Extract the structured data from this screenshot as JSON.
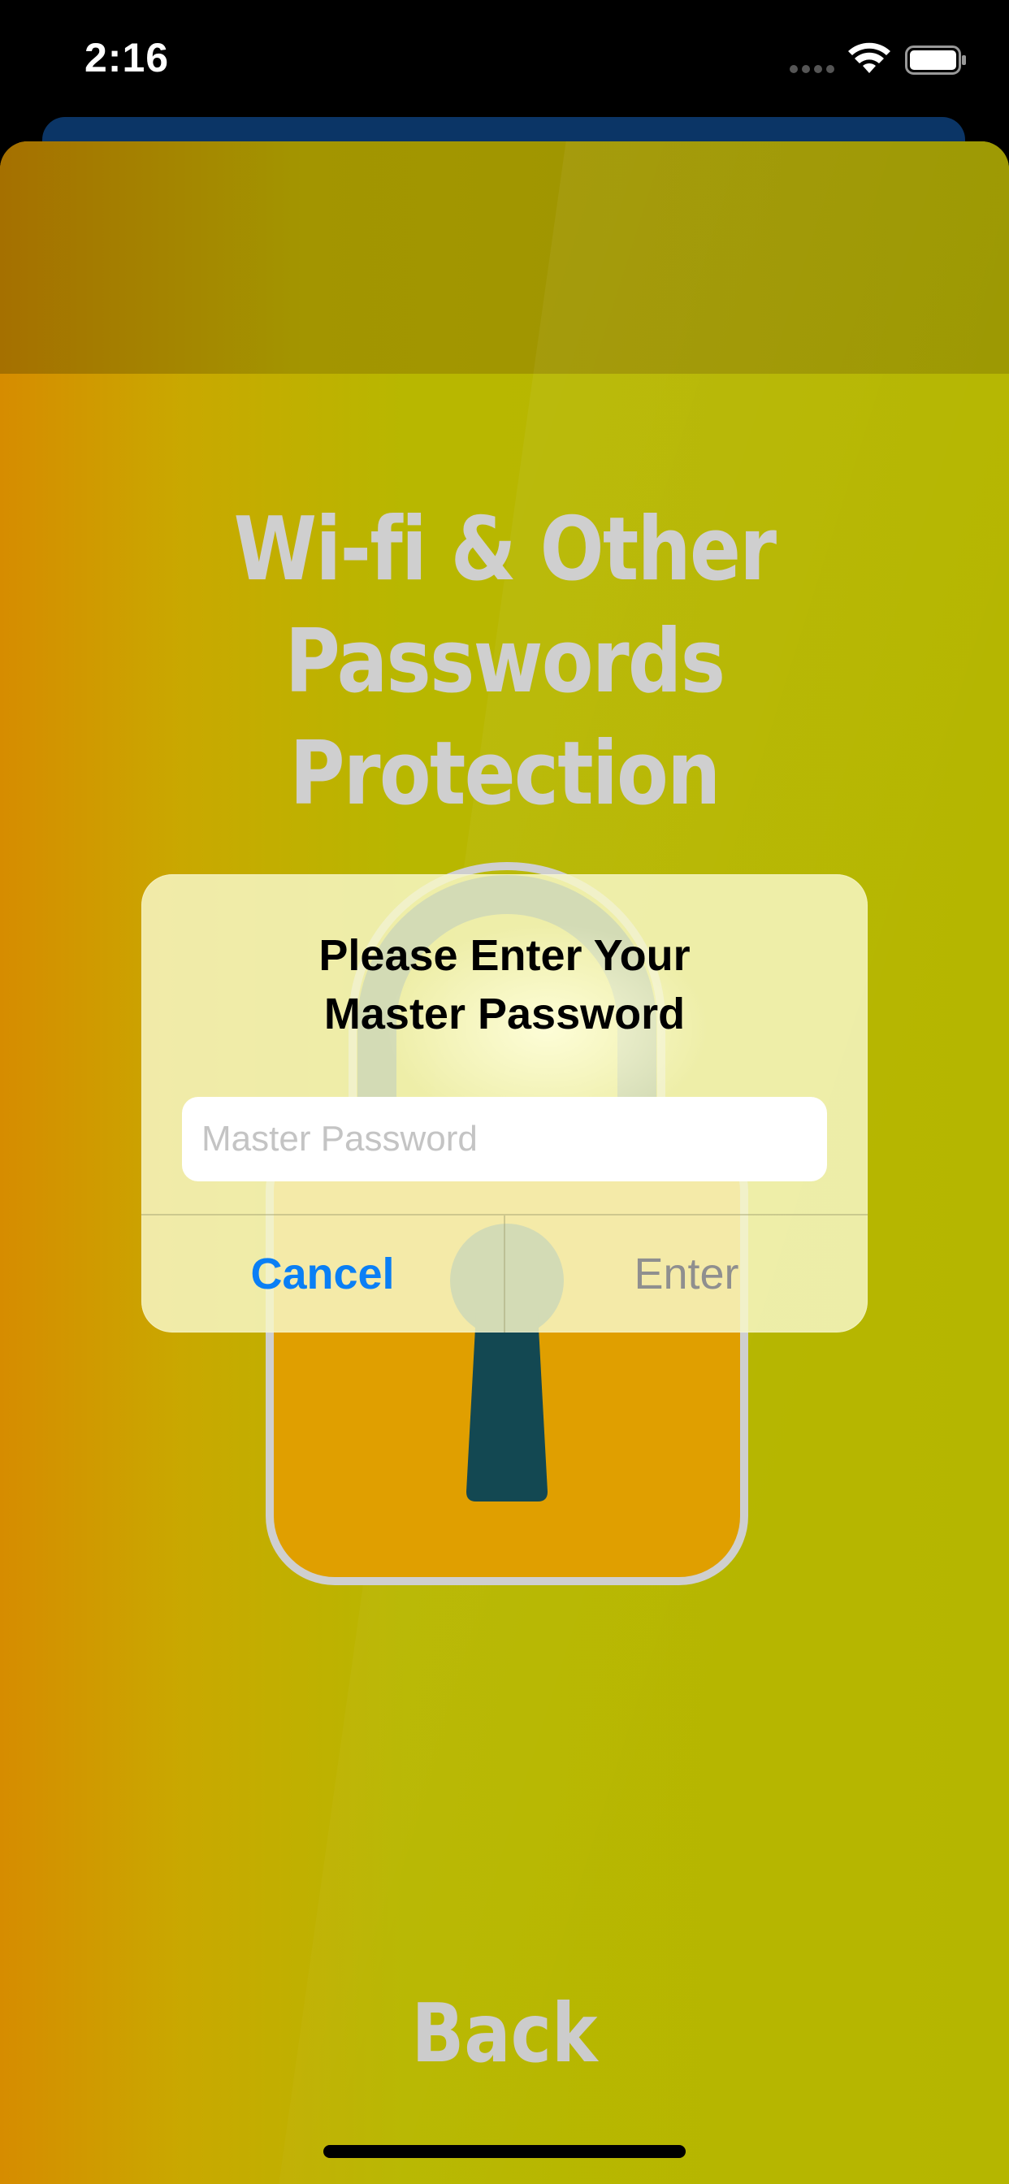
{
  "status_bar": {
    "time": "2:16"
  },
  "page": {
    "title_line1": "Wi-fi & Other",
    "title_line2": "Passwords Protection",
    "back_label": "Back"
  },
  "alert": {
    "title_line1": "Please Enter Your",
    "title_line2": "Master Password",
    "input_placeholder": "Master Password",
    "input_value": "",
    "cancel_label": "Cancel",
    "enter_label": "Enter"
  },
  "colors": {
    "accent_blue": "#0a7ff5",
    "background_yellow": "#b5b600",
    "background_orange": "#d68c00",
    "lock_body": "#e09f00",
    "lock_keyhole": "#134852"
  },
  "icons": [
    "signal-icon",
    "wifi-icon",
    "battery-icon",
    "lock-icon",
    "keyhole-icon"
  ]
}
